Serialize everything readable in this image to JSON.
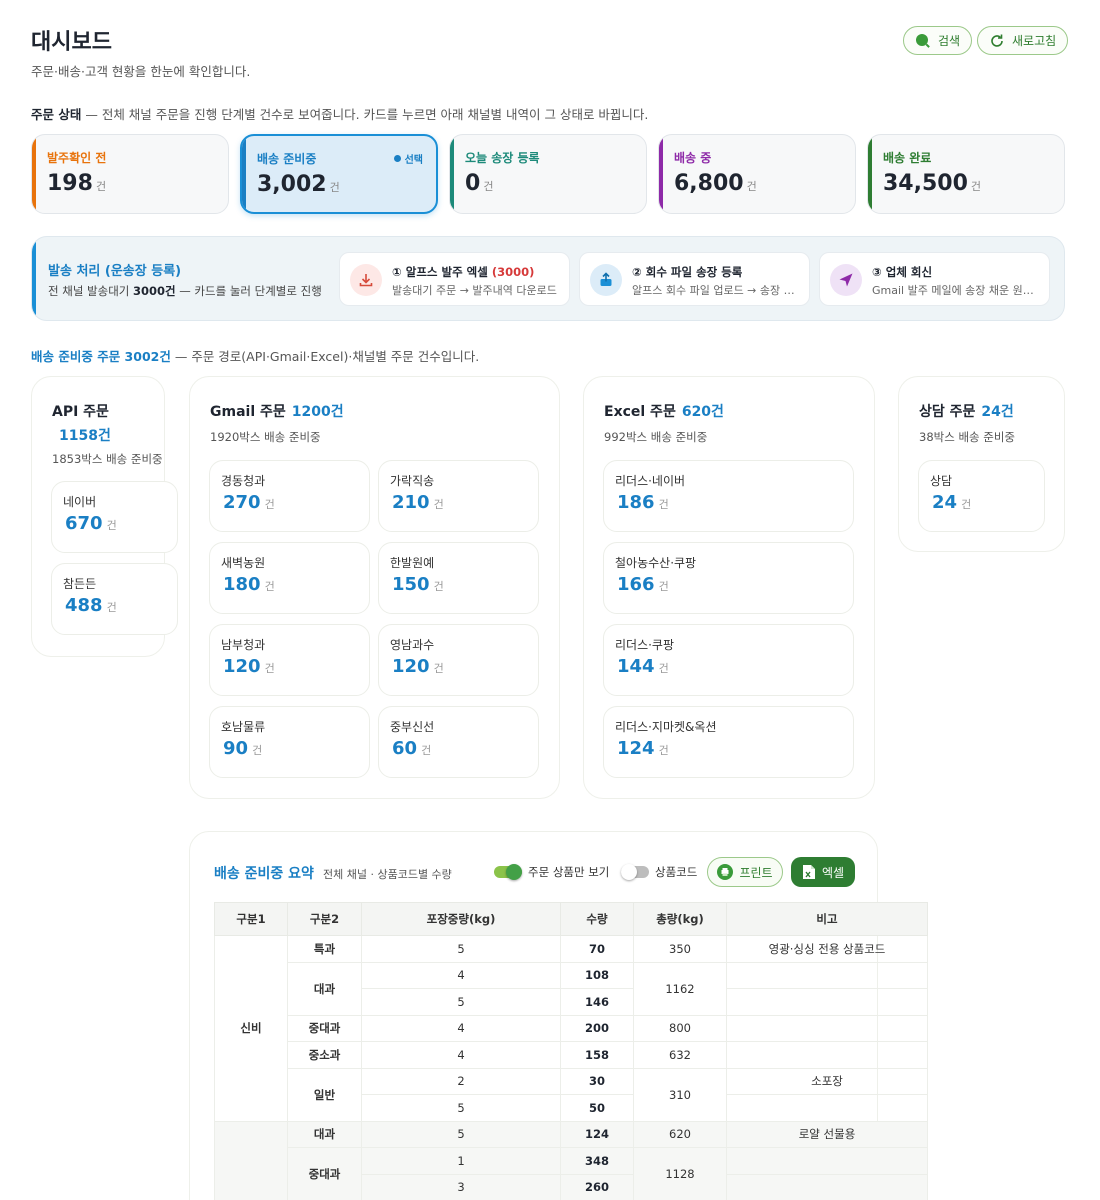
{
  "header": {
    "title": "대시보드",
    "subtitle": "주문·배송·고객 현황을 한눈에 확인합니다.",
    "search_label": "검색",
    "refresh_label": "새로고침"
  },
  "order_status": {
    "label": "주문 상태",
    "desc": "— 전체 채널 주문을 진행 단계별 건수로 보여줍니다. 카드를 누르면 아래 채널별 내역이 그 상태로 바뀝니다.",
    "unit": "건",
    "selected_badge": "선택",
    "cards": [
      {
        "label": "발주확인 전",
        "value": "198",
        "color": "#e8730c"
      },
      {
        "label": "배송 준비중",
        "value": "3,002",
        "color": "#1a7fc4"
      },
      {
        "label": "오늘 송장 등록",
        "value": "0",
        "color": "#1d8a7a"
      },
      {
        "label": "배송 중",
        "value": "6,800",
        "color": "#8e2aa8"
      },
      {
        "label": "배송 완료",
        "value": "34,500",
        "color": "#2e7d32"
      }
    ]
  },
  "processing": {
    "title": "발송 처리 (운송장 등록)",
    "desc_pre": "전 채널 발송대기 ",
    "desc_count": "3000건",
    "desc_post": " — 카드를 눌러 단계별로 진행",
    "actions": [
      {
        "title": "① 알프스 발주 엑셀 ",
        "count": "(3000)",
        "desc": "발송대기 주문 → 발주내역 다운로드",
        "icon": "download-icon"
      },
      {
        "title": "② 회수 파일 송장 등록",
        "count": "",
        "desc": "알프스 회수 파일 업로드 → 송장 등록",
        "icon": "upload-icon"
      },
      {
        "title": "③ 업체 회신",
        "count": "",
        "desc": "Gmail 발주 메일에 송장 채운 원본 회신",
        "icon": "send-icon"
      }
    ]
  },
  "channel_section": {
    "label": "배송 준비중 주문 3002건",
    "desc": "— 주문 경로(API·Gmail·Excel)·채널별 주문 건수입니다."
  },
  "panels": {
    "unit": "건",
    "api": {
      "title": "API 주문",
      "count": "1158건",
      "sub": "1853박스  배송 준비중",
      "tiles": [
        {
          "name": "네이버",
          "value": "670"
        },
        {
          "name": "참든든",
          "value": "488"
        }
      ]
    },
    "gmail": {
      "title": "Gmail 주문",
      "count": "1200건",
      "sub": "1920박스  배송 준비중",
      "tiles": [
        {
          "name": "경동청과",
          "value": "270"
        },
        {
          "name": "가락직송",
          "value": "210"
        },
        {
          "name": "새벽농원",
          "value": "180"
        },
        {
          "name": "한발원예",
          "value": "150"
        },
        {
          "name": "남부청과",
          "value": "120"
        },
        {
          "name": "영남과수",
          "value": "120"
        },
        {
          "name": "호남물류",
          "value": "90"
        },
        {
          "name": "중부신선",
          "value": "60"
        }
      ]
    },
    "excel": {
      "title": "Excel 주문",
      "count": "620건",
      "sub": "992박스  배송 준비중",
      "tiles": [
        {
          "name": "리더스·네이버",
          "value": "186"
        },
        {
          "name": "철아농수산·쿠팡",
          "value": "166"
        },
        {
          "name": "리더스·쿠팡",
          "value": "144"
        },
        {
          "name": "리더스·지마켓&옥션",
          "value": "124"
        }
      ]
    },
    "consult": {
      "title": "상담 주문",
      "count": "24건",
      "sub": "38박스  배송 준비중",
      "tiles": [
        {
          "name": "상담",
          "value": "24"
        }
      ]
    }
  },
  "summary": {
    "title": "배송 준비중 요약",
    "sub": "전체 채널 · 상품코드별 수량",
    "toggle_ordered_label": "주문 상품만 보기",
    "toggle_ordered_on": true,
    "toggle_code_label": "상품코드",
    "toggle_code_on": false,
    "print_label": "프린트",
    "excel_label": "엑셀",
    "columns": [
      "구분1",
      "구분2",
      "포장중량(kg)",
      "수량",
      "총량(kg)",
      "비고"
    ],
    "groups": [
      {
        "name": "신비",
        "shade": false,
        "subs": [
          {
            "name": "특과",
            "rows": [
              {
                "weight": "5",
                "qty": "70"
              }
            ],
            "total": "350",
            "notes": [
              "영광·싱싱 전용 상품코드"
            ]
          },
          {
            "name": "대과",
            "rows": [
              {
                "weight": "4",
                "qty": "108"
              },
              {
                "weight": "5",
                "qty": "146"
              }
            ],
            "total": "1162",
            "notes": [
              "",
              ""
            ]
          },
          {
            "name": "중대과",
            "rows": [
              {
                "weight": "4",
                "qty": "200"
              }
            ],
            "total": "800",
            "notes": [
              ""
            ]
          },
          {
            "name": "중소과",
            "rows": [
              {
                "weight": "4",
                "qty": "158"
              }
            ],
            "total": "632",
            "notes": [
              ""
            ]
          },
          {
            "name": "일반",
            "rows": [
              {
                "weight": "2",
                "qty": "30"
              },
              {
                "weight": "5",
                "qty": "50"
              }
            ],
            "total": "310",
            "notes": [
              "소포장",
              ""
            ]
          }
        ]
      },
      {
        "name": "",
        "shade": true,
        "subs": [
          {
            "name": "대과",
            "rows": [
              {
                "weight": "5",
                "qty": "124"
              }
            ],
            "total": "620",
            "notes": [
              "로얄 선물용"
            ]
          },
          {
            "name": "중대과",
            "rows": [
              {
                "weight": "1",
                "qty": "348"
              },
              {
                "weight": "3",
                "qty": "260"
              }
            ],
            "total": "1128",
            "notes": [
              "",
              ""
            ]
          }
        ]
      }
    ]
  }
}
